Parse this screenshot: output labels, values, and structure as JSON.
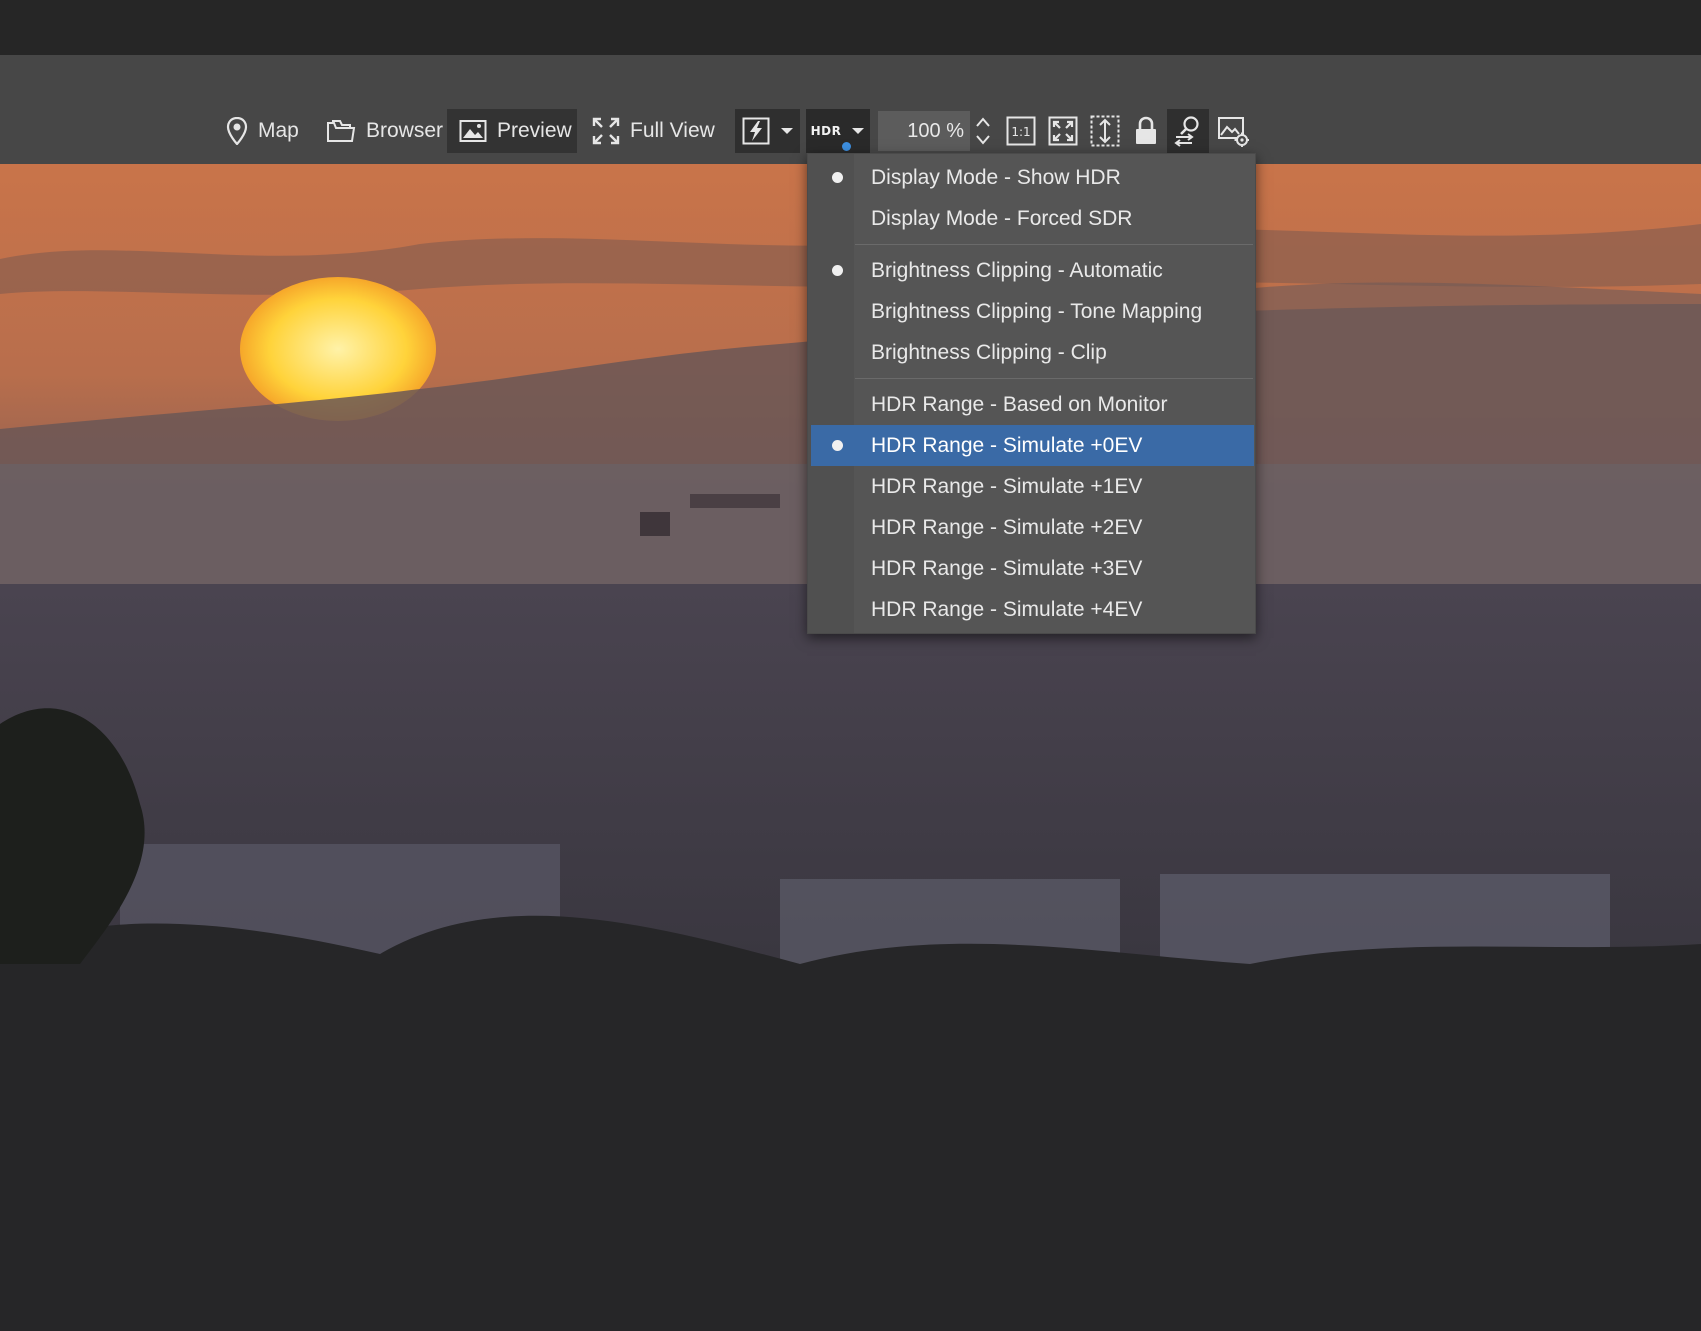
{
  "toolbar": {
    "map_label": "Map",
    "browser_label": "Browser",
    "preview_label": "Preview",
    "fullview_label": "Full View",
    "hdr_label": "HDR",
    "zoom_value": "100 %",
    "one_to_one_label": "1:1",
    "icons": [
      "map-pin-icon",
      "folder-icon",
      "image-icon",
      "expand-icon",
      "lightning-icon",
      "dropdown-arrow-icon",
      "hdr-icon",
      "one-to-one-icon",
      "fit-screen-icon",
      "fit-height-icon",
      "lock-icon",
      "compare-zoom-icon",
      "image-settings-icon"
    ],
    "active_view": "Preview"
  },
  "hdr_menu": {
    "groups": [
      {
        "items": [
          {
            "label": "Display Mode - Show HDR",
            "checked": true
          },
          {
            "label": "Display Mode - Forced SDR",
            "checked": false
          }
        ]
      },
      {
        "items": [
          {
            "label": "Brightness Clipping - Automatic",
            "checked": true
          },
          {
            "label": "Brightness Clipping - Tone Mapping",
            "checked": false
          },
          {
            "label": "Brightness Clipping - Clip",
            "checked": false
          }
        ]
      },
      {
        "items": [
          {
            "label": "HDR Range - Based on Monitor",
            "checked": false
          },
          {
            "label": "HDR Range - Simulate +0EV",
            "checked": true,
            "highlighted": true
          },
          {
            "label": "HDR Range - Simulate +1EV",
            "checked": false
          },
          {
            "label": "HDR Range - Simulate +2EV",
            "checked": false
          },
          {
            "label": "HDR Range - Simulate +3EV",
            "checked": false
          },
          {
            "label": "HDR Range - Simulate +4EV",
            "checked": false
          }
        ]
      }
    ]
  },
  "colors": {
    "accent": "#3a6aa6",
    "hdr_indicator": "#3d8fe0",
    "toolbar_bg": "#474747",
    "menu_bg": "#555555"
  }
}
